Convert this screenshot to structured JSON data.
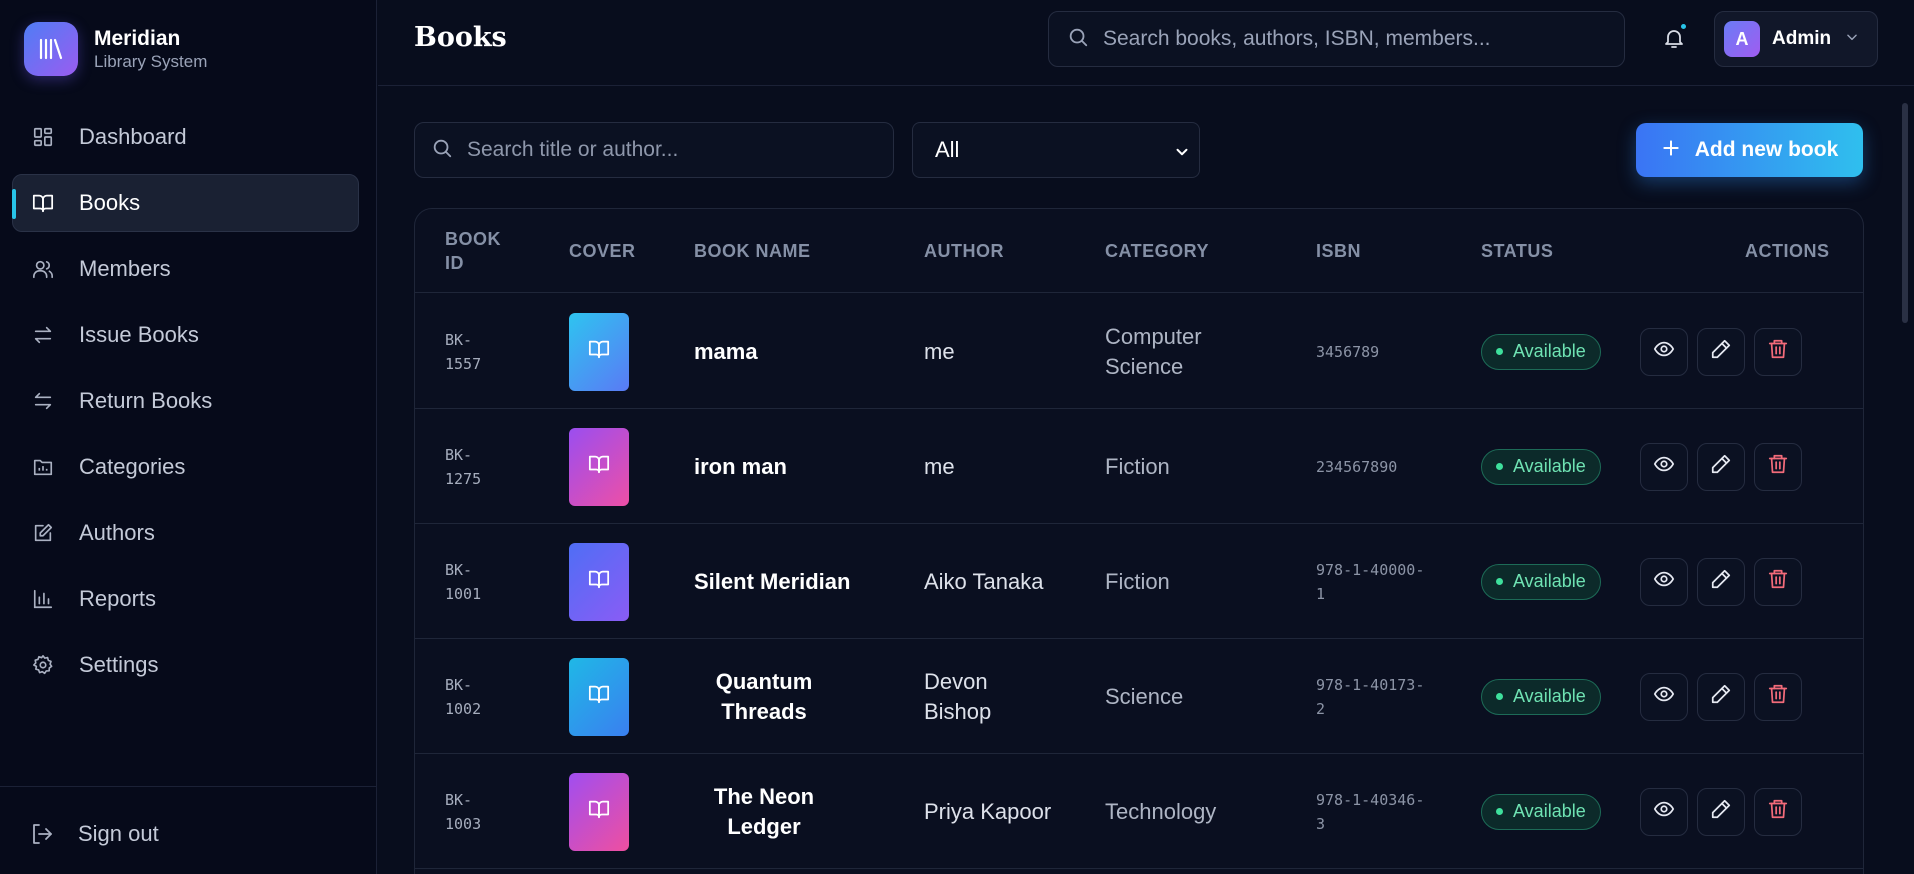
{
  "brand": {
    "name": "Meridian",
    "subtitle": "Library System"
  },
  "nav": [
    {
      "label": "Dashboard",
      "icon": "grid-icon",
      "active": false
    },
    {
      "label": "Books",
      "icon": "book-open-icon",
      "active": true
    },
    {
      "label": "Members",
      "icon": "users-icon",
      "active": false
    },
    {
      "label": "Issue Books",
      "icon": "swap-icon",
      "active": false
    },
    {
      "label": "Return Books",
      "icon": "return-icon",
      "active": false
    },
    {
      "label": "Categories",
      "icon": "folder-chart-icon",
      "active": false
    },
    {
      "label": "Authors",
      "icon": "edit-square-icon",
      "active": false
    },
    {
      "label": "Reports",
      "icon": "bar-chart-icon",
      "active": false
    },
    {
      "label": "Settings",
      "icon": "gear-icon",
      "active": false
    }
  ],
  "signout": {
    "label": "Sign out"
  },
  "header": {
    "title": "Books",
    "search_placeholder": "Search books, authors, ISBN, members...",
    "user": {
      "initial": "A",
      "name": "Admin"
    }
  },
  "filters": {
    "search_placeholder": "Search title or author...",
    "category_selected": "All",
    "add_button": "Add new book"
  },
  "table": {
    "columns": {
      "book_id": "BOOK ID",
      "cover": "COVER",
      "book_name": "BOOK NAME",
      "author": "AUTHOR",
      "category": "CATEGORY",
      "isbn": "ISBN",
      "status": "STATUS",
      "actions": "ACTIONS"
    },
    "rows": [
      {
        "id": "BK-1557",
        "name": "mama",
        "author": "me",
        "category": "Computer Science",
        "isbn": "3456789",
        "status": "Available",
        "cover_colors": [
          "#2ec4f0",
          "#5a7af5"
        ]
      },
      {
        "id": "BK-1275",
        "name": "iron man",
        "author": "me",
        "category": "Fiction",
        "isbn": "234567890",
        "status": "Available",
        "cover_colors": [
          "#9a4ef0",
          "#ee4fa6"
        ]
      },
      {
        "id": "BK-1001",
        "name": "Silent Meridian",
        "author": "Aiko Tanaka",
        "category": "Fiction",
        "isbn": "978-1-40000-1",
        "status": "Available",
        "cover_colors": [
          "#4f6ef5",
          "#8a5cf5"
        ]
      },
      {
        "id": "BK-1002",
        "name": "Quantum Threads",
        "author": "Devon Bishop",
        "category": "Science",
        "isbn": "978-1-40173-2",
        "status": "Available",
        "cover_colors": [
          "#1fb8e6",
          "#3a7ff0"
        ]
      },
      {
        "id": "BK-1003",
        "name": "The Neon Ledger",
        "author": "Priya Kapoor",
        "category": "Technology",
        "isbn": "978-1-40346-3",
        "status": "Available",
        "cover_colors": [
          "#a04ef0",
          "#ef4fa0"
        ]
      }
    ]
  },
  "colors": {
    "accent": "#28c4e8",
    "status_green": "#3ee09c",
    "delete_red": "#f26b7a"
  }
}
